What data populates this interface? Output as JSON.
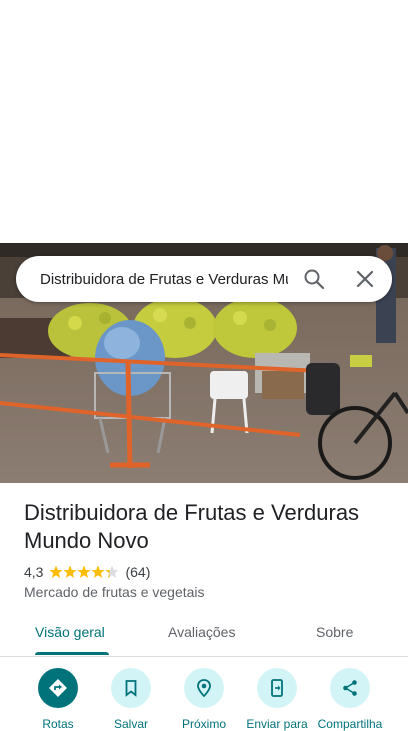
{
  "search": {
    "query": "Distribuidora de Frutas e Verduras Mundo Novo"
  },
  "place": {
    "title": "Distribuidora de Frutas e Verduras Mundo Novo",
    "rating": "4,3",
    "rating_value": 4.3,
    "review_count": "(64)",
    "category": "Mercado de frutas e vegetais"
  },
  "tabs": [
    {
      "label": "Visão geral",
      "active": true
    },
    {
      "label": "Avaliações",
      "active": false
    },
    {
      "label": "Sobre",
      "active": false
    }
  ],
  "actions": [
    {
      "label": "Rotas",
      "icon": "directions-icon"
    },
    {
      "label": "Salvar",
      "icon": "bookmark-icon"
    },
    {
      "label": "Próximo",
      "icon": "nearby-icon"
    },
    {
      "label": "Enviar para",
      "icon": "send-to-phone-icon"
    },
    {
      "label": "Compartilha",
      "icon": "share-icon"
    }
  ],
  "colors": {
    "accent": "#00737a",
    "accent_light": "#d3f4f7",
    "star": "#fbbc04"
  }
}
